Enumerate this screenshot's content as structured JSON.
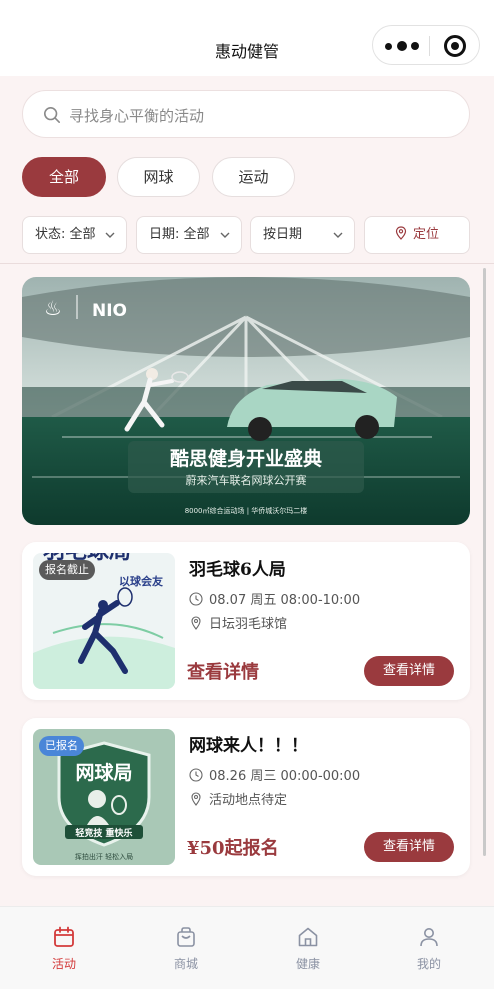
{
  "navbar": {
    "title": "惠动健管"
  },
  "search": {
    "placeholder": "寻找身心平衡的活动"
  },
  "categories": [
    {
      "label": "全部",
      "active": true
    },
    {
      "label": "网球",
      "active": false
    },
    {
      "label": "运动",
      "active": false
    }
  ],
  "filters": {
    "status": "状态: 全部",
    "date": "日期: 全部",
    "sort": "按日期",
    "location": "定位"
  },
  "banner": {
    "brand": "NIO",
    "headline": "酷思健身开业盛典",
    "subheadline": "蔚来汽车联名网球公开赛",
    "footer": "8000㎡综合运动场 | 华侨城沃尔玛二楼"
  },
  "activities": [
    {
      "badge": "报名截止",
      "badge_color": "#5a5a5a",
      "thumb_text": "羽毛球局",
      "thumb_sub": "以球会友",
      "title": "羽毛球6人局",
      "time": "08.07 周五 08:00-10:00",
      "location": "日坛羽毛球馆",
      "cta": "查看详情",
      "button": "查看详情"
    },
    {
      "badge": "已报名",
      "badge_color": "#4a86d8",
      "thumb_text": "网球局",
      "thumb_sub": "轻竞技 重快乐",
      "thumb_footer": "挥拍出汗 轻松入局",
      "title": "网球来人！！！",
      "time": "08.26 周三 00:00-00:00",
      "location": "活动地点待定",
      "cta": "¥50起报名",
      "button": "查看详情"
    }
  ],
  "tabbar": [
    {
      "label": "活动",
      "icon": "calendar-icon",
      "active": true
    },
    {
      "label": "商城",
      "icon": "bag-icon",
      "active": false
    },
    {
      "label": "健康",
      "icon": "home-icon",
      "active": false
    },
    {
      "label": "我的",
      "icon": "user-icon",
      "active": false
    }
  ],
  "colors": {
    "accent": "#9a3a3e",
    "tab_active": "#d33a3a",
    "badge_registered": "#4a86d8"
  }
}
